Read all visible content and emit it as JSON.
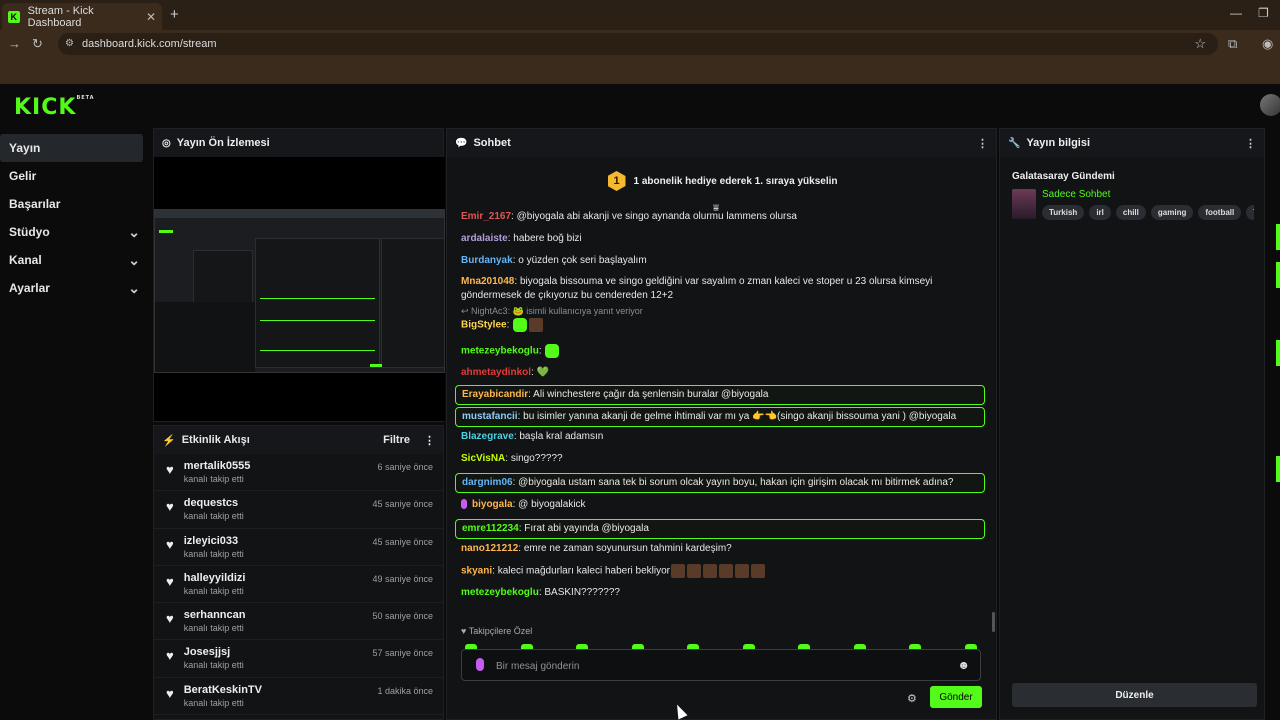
{
  "browser": {
    "tab_title": "Stream - Kick Dashboard",
    "url": "dashboard.kick.com/stream"
  },
  "app": {
    "logo": "KICK",
    "logo_badge": "BETA"
  },
  "sidebar": {
    "items": [
      {
        "label": "Yayın",
        "expandable": false
      },
      {
        "label": "Gelir",
        "expandable": false
      },
      {
        "label": "Başarılar",
        "expandable": false
      },
      {
        "label": "Stüdyo",
        "expandable": true
      },
      {
        "label": "Kanal",
        "expandable": true
      },
      {
        "label": "Ayarlar",
        "expandable": true
      }
    ]
  },
  "preview": {
    "title": "Yayın Ön İzlemesi"
  },
  "activity": {
    "title": "Etkinlik Akışı",
    "filter_label": "Filtre",
    "items": [
      {
        "user": "mertalik0555",
        "action": "kanalı takip etti",
        "time": "6 saniye önce"
      },
      {
        "user": "dequestcs",
        "action": "kanalı takip etti",
        "time": "45 saniye önce"
      },
      {
        "user": "izleyici033",
        "action": "kanalı takip etti",
        "time": "45 saniye önce"
      },
      {
        "user": "halleyyildizi",
        "action": "kanalı takip etti",
        "time": "49 saniye önce"
      },
      {
        "user": "serhanncan",
        "action": "kanalı takip etti",
        "time": "50 saniye önce"
      },
      {
        "user": "Josesjjsj",
        "action": "kanalı takip etti",
        "time": "57 saniye önce"
      },
      {
        "user": "BeratKeskinTV",
        "action": "kanalı takip etti",
        "time": "1 dakika önce"
      }
    ]
  },
  "chat": {
    "title": "Sohbet",
    "pinned_rank": "1",
    "pinned_text": "1 abonelik hediye ederek 1. sıraya yükselin",
    "messages": [
      {
        "user": "Emir_2167",
        "color": "#e05555",
        "text": "@biyogala abi akanji ve singo aynanda olurmu lammens olursa"
      },
      {
        "user": "ardalaiste",
        "color": "#b39ddb",
        "text": "habere boğ bizi"
      },
      {
        "user": "Burdanyak",
        "color": "#64b5f6",
        "text": "o yüzden çok seri başlayalım"
      },
      {
        "user": "Mna201048",
        "color": "#ffb74d",
        "text": "biyogala bissouma ve singo geldiğini var sayalım o zman kaleci ve stoper u 23 olursa kimseyi göndermesek de çıkıyoruz bu cendereden 12+2"
      },
      {
        "reply_to": "NightAc3: 🐸 isimli kullanıcıya yanıt veriyor",
        "user": "BigStylee",
        "color": "#ffd54f",
        "text": ""
      },
      {
        "user": "metezeybekoglu",
        "color": "#53fc18",
        "text": ""
      },
      {
        "user": "ahmetaydinkol",
        "color": "#e53935",
        "text": "💚"
      },
      {
        "user": "Erayabicandir",
        "color": "#ffb74d",
        "text": "Ali winchestere çağır da şenlensin buralar @biyogala",
        "highlight": true
      },
      {
        "user": "mustafancii",
        "color": "#90caf9",
        "text": "bu isimler yanına akanji de gelme ihtimali var mı ya 👉👈(singo akanji bissouma yani ) @biyogala",
        "highlight": true
      },
      {
        "user": "Blazegrave",
        "color": "#4dd0e1",
        "text": "başla kral adamsın"
      },
      {
        "user": "SicVisNA",
        "color": "#c6ff00",
        "text": "singo?????"
      },
      {
        "user": "dargnim06",
        "color": "#64b5f6",
        "text": "@biyogala ustam sana tek bi sorum olcak yayın boyu, hakan için girişim olacak mı bitirmek adına?",
        "highlight": true
      },
      {
        "user": "biyogala",
        "color": "#ffb74d",
        "text": "@ biyogalakick",
        "broadcaster": true
      },
      {
        "user": "emre112234",
        "color": "#53fc18",
        "text": "Fırat abi yayında @biyogala",
        "highlight": true
      },
      {
        "user": "nano121212",
        "color": "#ffb74d",
        "text": "emre ne zaman soyunursun tahmini kardeşim?"
      },
      {
        "user": "skyani",
        "color": "#ffb74d",
        "text": "kaleci mağdurları kaleci haberi bekliyor"
      },
      {
        "user": "metezeybekoglu",
        "color": "#53fc18",
        "text": "BASKIN???????"
      }
    ],
    "emote_section_label": "Takipçilere Özel",
    "input_placeholder": "Bir mesaj gönderin",
    "send_label": "Gönder"
  },
  "stream_info": {
    "title": "Yayın bilgisi",
    "stream_title": "Galatasaray Gündemi",
    "category": "Sadece Sohbet",
    "tags": [
      "Turkish",
      "irl",
      "chill",
      "gaming",
      "football",
      "Tur"
    ],
    "edit_label": "Düzenle"
  },
  "colors": {
    "accent": "#53fc18",
    "panel": "#111315",
    "background": "#0b0b0b"
  }
}
